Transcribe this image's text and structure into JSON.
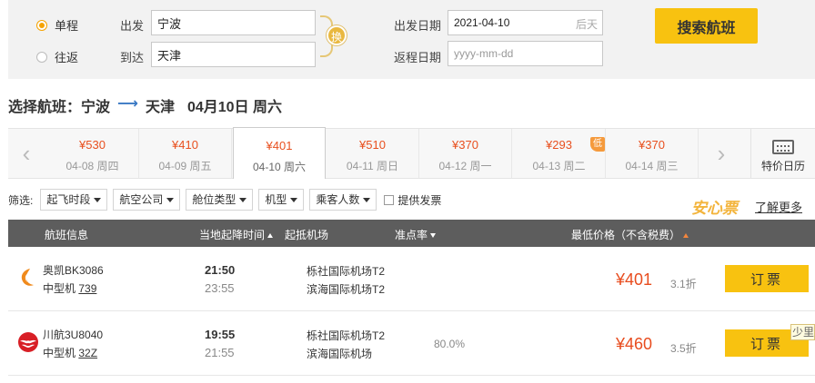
{
  "search": {
    "trip_types": [
      "单程",
      "往返"
    ],
    "selected_trip": "单程",
    "from_label": "出发",
    "to_label": "到达",
    "from_value": "宁波",
    "to_value": "天津",
    "swap_label": "换",
    "depart_date_label": "出发日期",
    "depart_date_value": "2021-04-10",
    "depart_date_hint": "后天",
    "return_date_label": "返程日期",
    "return_date_placeholder": "yyyy-mm-dd",
    "search_button": "搜索航班"
  },
  "route": {
    "prefix": "选择航班：",
    "from": "宁波",
    "arrow": "⟶",
    "to": "天津",
    "date": "04月10日 周六"
  },
  "dates": [
    {
      "price": "¥530",
      "date": "04-08 周四",
      "selected": false,
      "badge": ""
    },
    {
      "price": "¥410",
      "date": "04-09 周五",
      "selected": false,
      "badge": ""
    },
    {
      "price": "¥401",
      "date": "04-10 周六",
      "selected": true,
      "badge": ""
    },
    {
      "price": "¥510",
      "date": "04-11 周日",
      "selected": false,
      "badge": ""
    },
    {
      "price": "¥370",
      "date": "04-12 周一",
      "selected": false,
      "badge": ""
    },
    {
      "price": "¥293",
      "date": "04-13 周二",
      "selected": false,
      "badge": "低"
    },
    {
      "price": "¥370",
      "date": "04-14 周三",
      "selected": false,
      "badge": ""
    }
  ],
  "calendar_label": "特价日历",
  "filter": {
    "label": "筛选:",
    "dropdowns": [
      "起飞时段",
      "航空公司",
      "舱位类型",
      "机型",
      "乘客人数"
    ],
    "checkbox_label": "提供发票"
  },
  "promo": {
    "anxin": "安心票",
    "more": "了解更多"
  },
  "table_headers": {
    "flight": "航班信息",
    "time": "当地起降时间",
    "airport": "起抵机场",
    "ontime": "准点率",
    "price": "最低价格（不含税费）"
  },
  "flights": [
    {
      "airline": "奥凯BK3086",
      "plane_type": "中型机",
      "plane_model": "739",
      "depart_time": "21:50",
      "arrive_time": "23:55",
      "depart_airport": "栎社国际机场T2",
      "arrive_airport": "滨海国际机场T2",
      "ontime": "",
      "price": "¥401",
      "discount": "3.1折",
      "book_label": "订票"
    },
    {
      "airline": "川航3U8040",
      "plane_type": "中型机",
      "plane_model": "32Z",
      "depart_time": "19:55",
      "arrive_time": "21:55",
      "depart_airport": "栎社国际机场T2",
      "arrive_airport": "滨海国际机场",
      "ontime": "80.0%",
      "price": "¥460",
      "discount": "3.5折",
      "book_label": "订票"
    }
  ],
  "less_tooltip": "少里",
  "colors": {
    "accent": "#f8c210",
    "price": "#e84c1e",
    "header": "#5d5d5d"
  }
}
